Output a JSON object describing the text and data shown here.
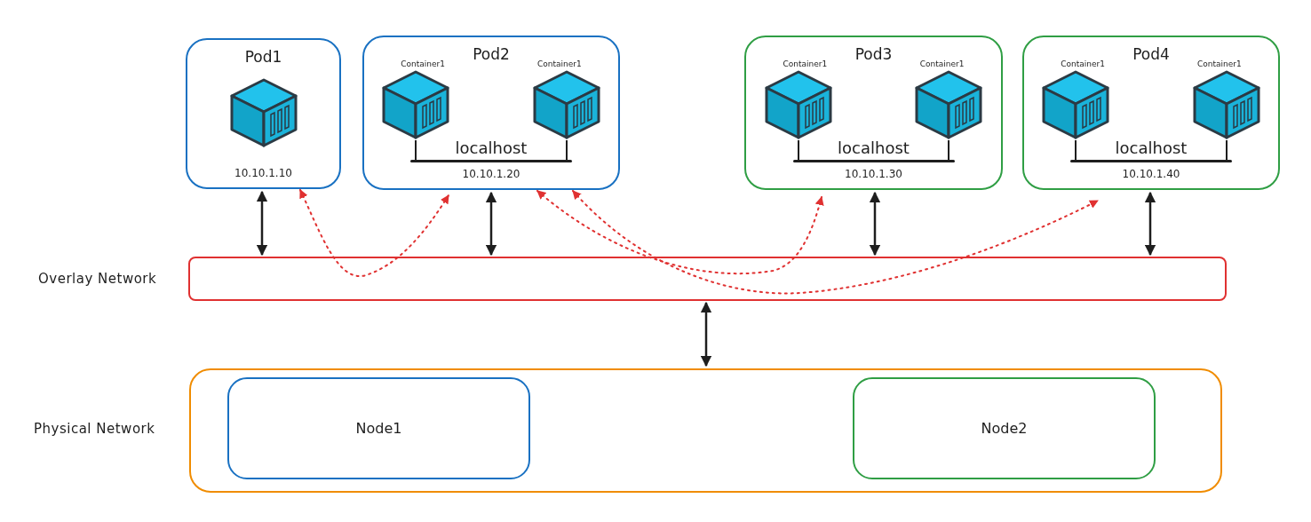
{
  "pods": [
    {
      "title": "Pod1",
      "color": "#1971c2",
      "kind": "single",
      "ip": "10.10.1.10"
    },
    {
      "title": "Pod2",
      "color": "#1971c2",
      "kind": "shared",
      "containers": [
        "Container1",
        "Container1"
      ],
      "bus_label": "localhost",
      "ip": "10.10.1.20"
    },
    {
      "title": "Pod3",
      "color": "#2f9e44",
      "kind": "shared",
      "containers": [
        "Container1",
        "Container1"
      ],
      "bus_label": "localhost",
      "ip": "10.10.1.30"
    },
    {
      "title": "Pod4",
      "color": "#2f9e44",
      "kind": "shared",
      "containers": [
        "Container1",
        "Container1"
      ],
      "bus_label": "localhost",
      "ip": "10.10.1.40"
    }
  ],
  "overlay_network": {
    "label": "Overlay Network",
    "color": "#e03131"
  },
  "physical_network": {
    "label": "Physical Network",
    "color": "#f08c00",
    "nodes": [
      {
        "label": "Node1",
        "color": "#1971c2"
      },
      {
        "label": "Node2",
        "color": "#2f9e44"
      }
    ]
  }
}
